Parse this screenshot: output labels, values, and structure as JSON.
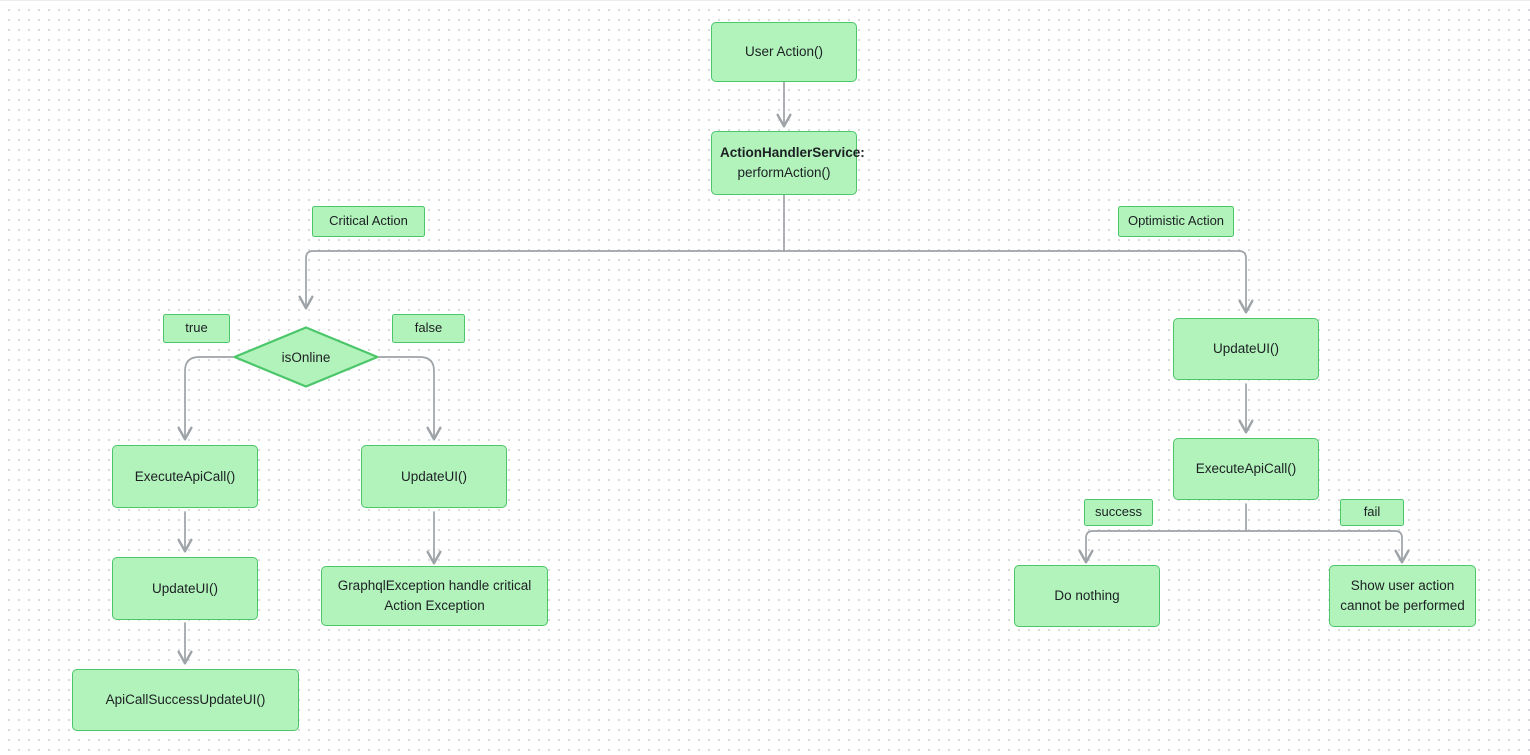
{
  "diagram": {
    "type": "flowchart",
    "background": "#ffffff",
    "grid_dot_color": "#d3d3d8",
    "node_fill": "#b2f2bb",
    "node_border": "#4cc66a",
    "edge_color": "#9ea3a8",
    "text_color": "#1c2023",
    "nodes": {
      "user_action": {
        "text": "User Action()"
      },
      "action_handler_title": {
        "text": "ActionHandlerService:"
      },
      "action_handler_sub": {
        "text": "performAction()"
      },
      "critical_action_label": {
        "text": "Critical Action"
      },
      "optimistic_action_label": {
        "text": "Optimistic Action"
      },
      "true_label": {
        "text": "true"
      },
      "false_label": {
        "text": "false"
      },
      "is_online": {
        "text": "isOnline"
      },
      "execute_api_call_left": {
        "text": "ExecuteApiCall()"
      },
      "update_ui_false": {
        "text": "UpdateUI()"
      },
      "update_ui_true": {
        "text": "UpdateUI()"
      },
      "graphql_exception_line1": {
        "text": "GraphqlException handle critical"
      },
      "graphql_exception_line2": {
        "text": "Action Exception"
      },
      "api_call_success": {
        "text": "ApiCallSuccessUpdateUI()"
      },
      "update_ui_optimistic": {
        "text": "UpdateUI()"
      },
      "execute_api_call_right": {
        "text": "ExecuteApiCall()"
      },
      "success_label": {
        "text": "success"
      },
      "fail_label": {
        "text": "fail"
      },
      "do_nothing": {
        "text": "Do nothing"
      },
      "show_user_action_line1": {
        "text": "Show user action"
      },
      "show_user_action_line2": {
        "text": "cannot be performed"
      }
    }
  }
}
